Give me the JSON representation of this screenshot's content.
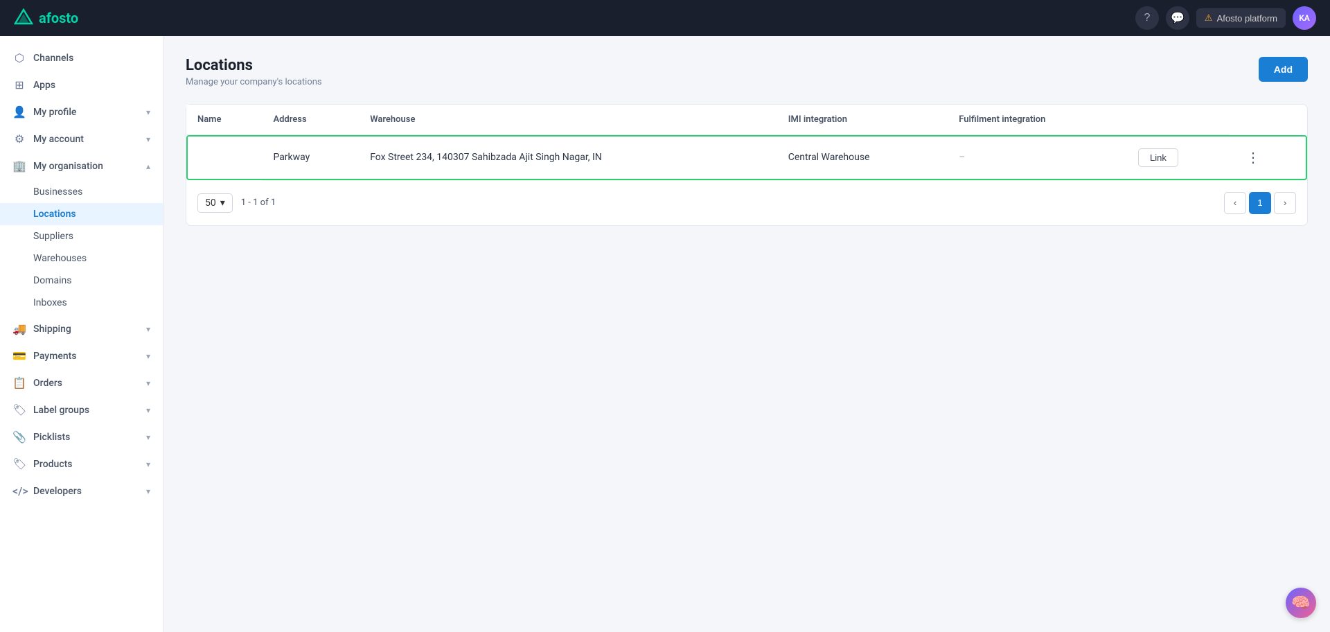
{
  "app": {
    "logo_text": "afosto",
    "platform_label": "Afosto platform",
    "avatar_text": "KA",
    "help_icon": "?",
    "chat_icon": "💬"
  },
  "sidebar": {
    "items": [
      {
        "id": "channels",
        "label": "Channels",
        "icon": "⬡",
        "expandable": false
      },
      {
        "id": "apps",
        "label": "Apps",
        "icon": "⊞",
        "expandable": false
      },
      {
        "id": "my-profile",
        "label": "My profile",
        "icon": "👤",
        "expandable": true
      },
      {
        "id": "my-account",
        "label": "My account",
        "icon": "⚙",
        "expandable": true
      },
      {
        "id": "my-organisation",
        "label": "My organisation",
        "icon": "🏢",
        "expandable": true,
        "expanded": true
      }
    ],
    "sub_items": [
      {
        "id": "businesses",
        "label": "Businesses"
      },
      {
        "id": "locations",
        "label": "Locations",
        "active": true
      },
      {
        "id": "suppliers",
        "label": "Suppliers"
      },
      {
        "id": "warehouses",
        "label": "Warehouses"
      },
      {
        "id": "domains",
        "label": "Domains"
      },
      {
        "id": "inboxes",
        "label": "Inboxes"
      }
    ],
    "bottom_items": [
      {
        "id": "shipping",
        "label": "Shipping",
        "icon": "🚚",
        "expandable": true
      },
      {
        "id": "payments",
        "label": "Payments",
        "icon": "💳",
        "expandable": true
      },
      {
        "id": "orders",
        "label": "Orders",
        "icon": "📋",
        "expandable": true
      },
      {
        "id": "label-groups",
        "label": "Label groups",
        "icon": "🏷",
        "expandable": true
      },
      {
        "id": "picklists",
        "label": "Picklists",
        "icon": "📎",
        "expandable": true
      },
      {
        "id": "products",
        "label": "Products",
        "icon": "🏷",
        "expandable": true
      },
      {
        "id": "developers",
        "label": "Developers",
        "icon": "</>",
        "expandable": true
      }
    ]
  },
  "page": {
    "title": "Locations",
    "subtitle": "Manage your company's locations",
    "add_button": "Add"
  },
  "table": {
    "columns": [
      "Name",
      "Address",
      "Warehouse",
      "IMI integration",
      "Fulfilment integration"
    ],
    "rows": [
      {
        "name": "Parkway",
        "address": "Fox Street 234, 140307 Sahibzada Ajit Singh Nagar, IN",
        "warehouse": "Central Warehouse",
        "imi_integration": "–",
        "fulfilment_integration": "Link",
        "highlighted": true
      }
    ]
  },
  "pagination": {
    "per_page": "50",
    "info": "1 - 1 of 1",
    "current_page": "1"
  }
}
